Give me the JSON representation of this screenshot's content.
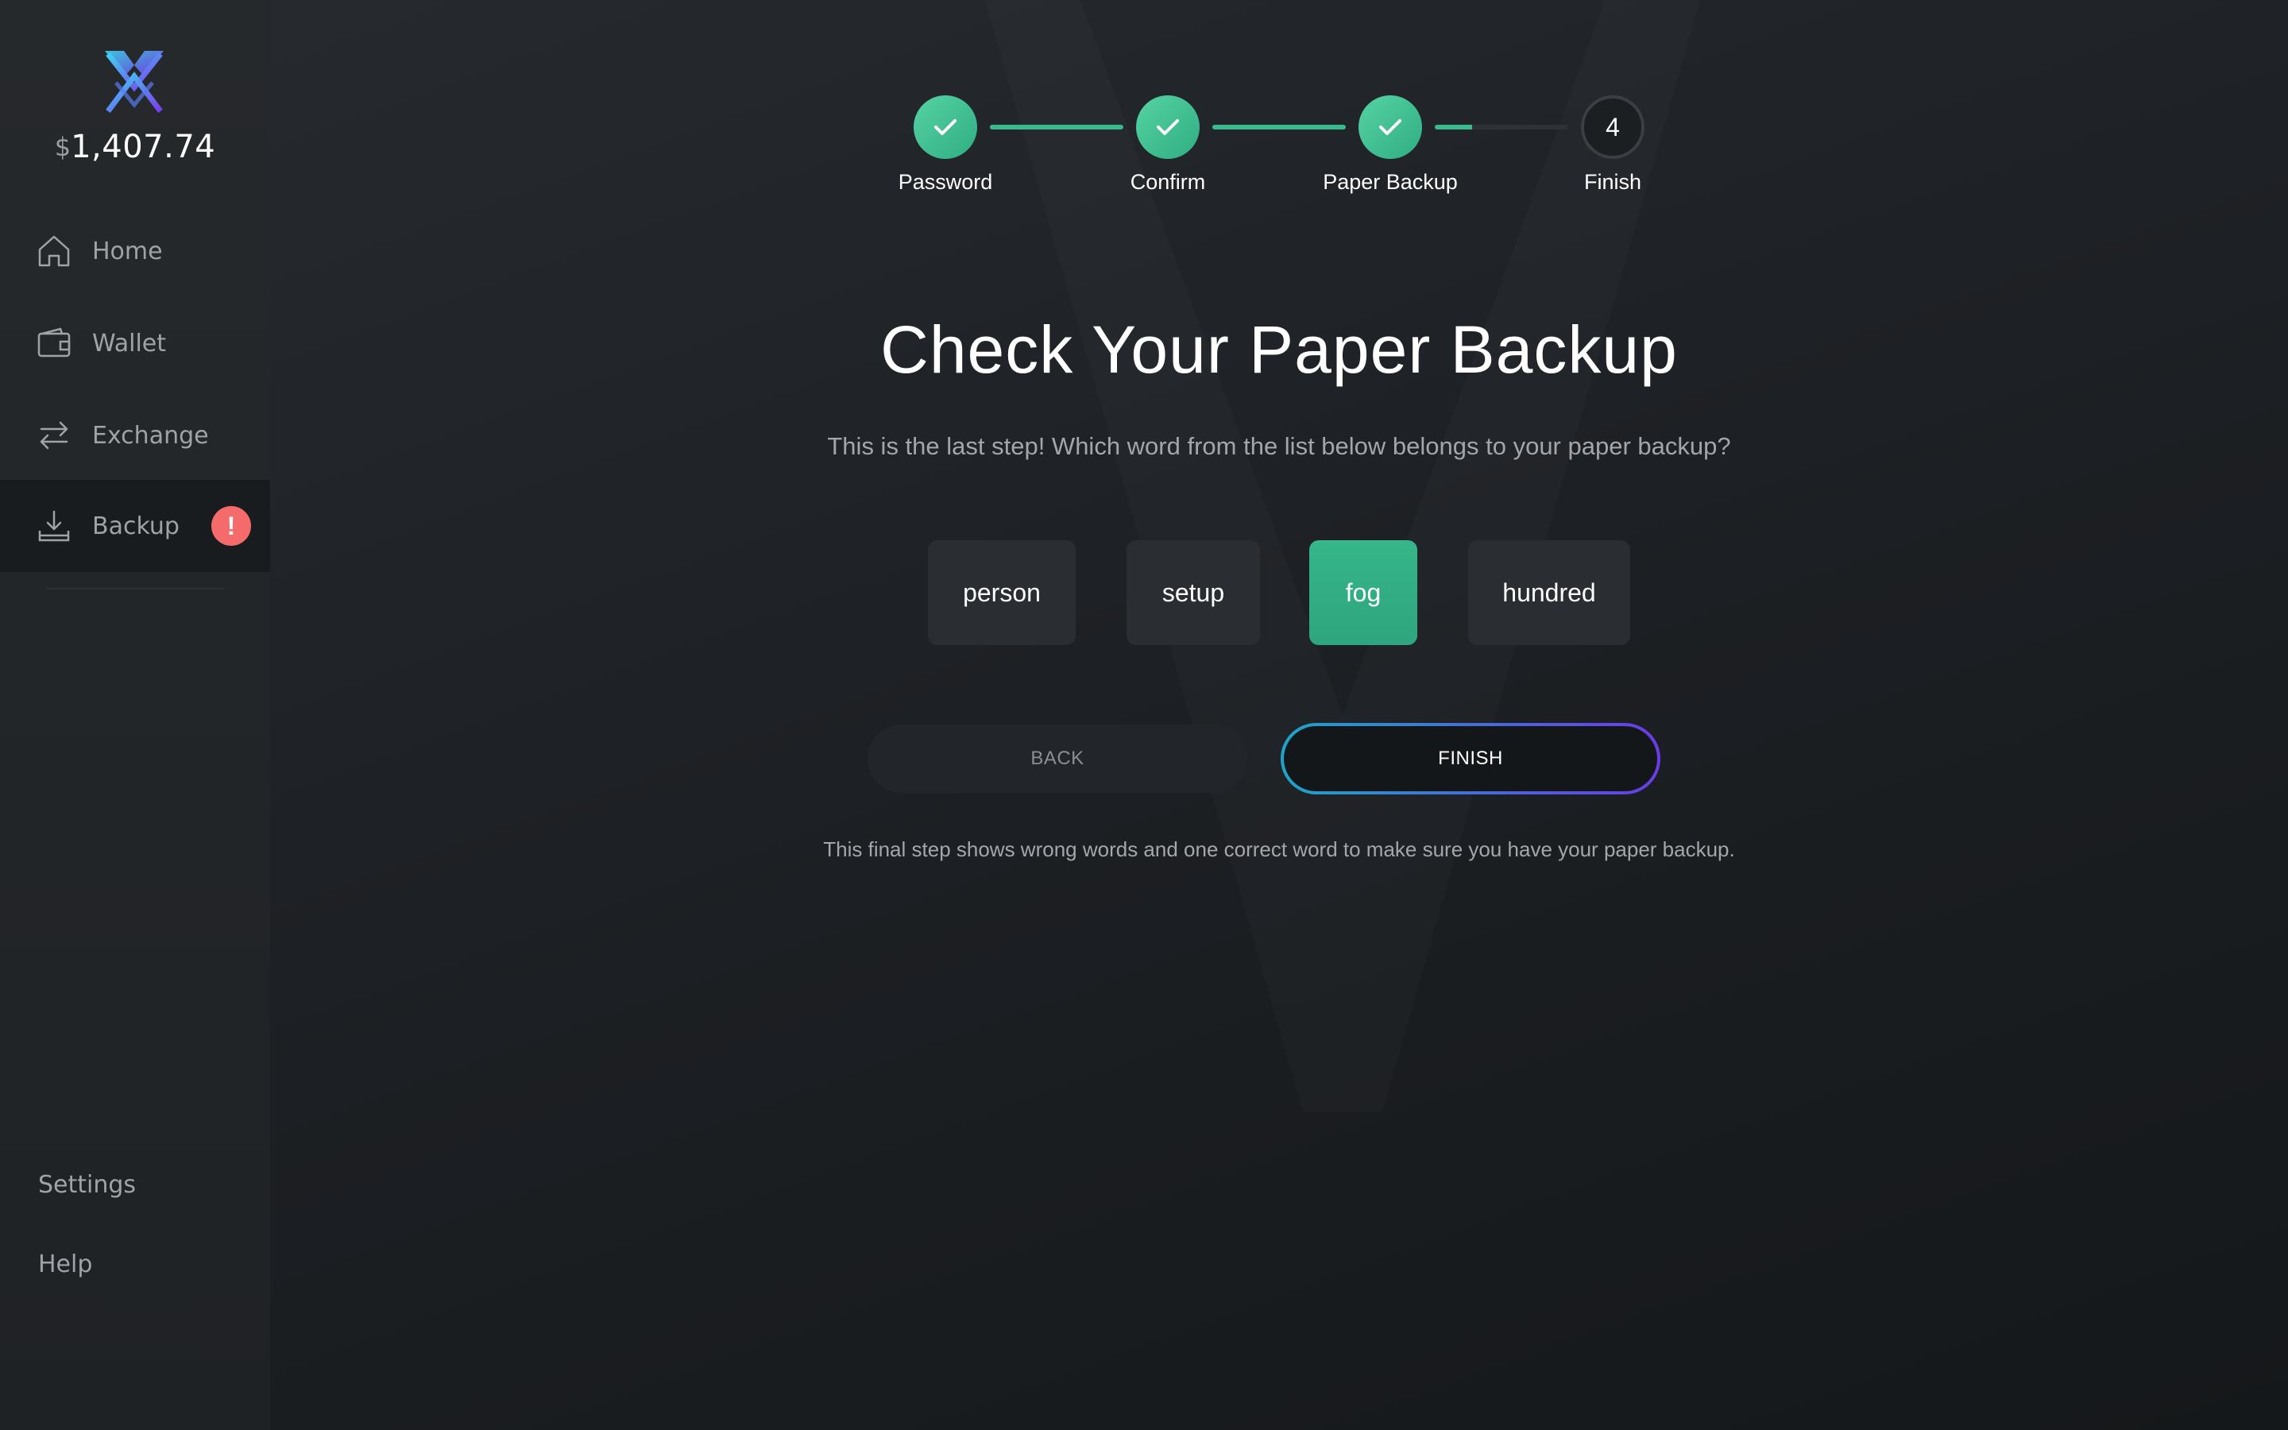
{
  "sidebar": {
    "balance_currency": "$",
    "balance_amount": "1,407.74",
    "items": [
      {
        "label": "Home",
        "icon": "home-icon"
      },
      {
        "label": "Wallet",
        "icon": "wallet-icon"
      },
      {
        "label": "Exchange",
        "icon": "exchange-icon"
      },
      {
        "label": "Backup",
        "icon": "backup-icon",
        "active": true,
        "badge": "!"
      }
    ],
    "bottom": [
      {
        "label": "Settings"
      },
      {
        "label": "Help"
      }
    ]
  },
  "stepper": {
    "steps": [
      {
        "label": "Password",
        "state": "done"
      },
      {
        "label": "Confirm",
        "state": "done"
      },
      {
        "label": "Paper Backup",
        "state": "done"
      },
      {
        "label": "Finish",
        "state": "todo",
        "number": "4"
      }
    ]
  },
  "main": {
    "title": "Check Your Paper Backup",
    "subtitle": "This is the last step! Which word from the list below belongs to your paper backup?",
    "words": [
      "person",
      "setup",
      "fog",
      "hundred"
    ],
    "selected_word": "fog",
    "back_label": "BACK",
    "finish_label": "FINISH",
    "footnote": "This final step shows wrong words and one correct word to make sure you have your paper backup."
  },
  "colors": {
    "accent_green": "#36bb8d",
    "badge_red": "#f56a6a",
    "gradient_start": "#1fa3c9",
    "gradient_end": "#6a3be8"
  }
}
